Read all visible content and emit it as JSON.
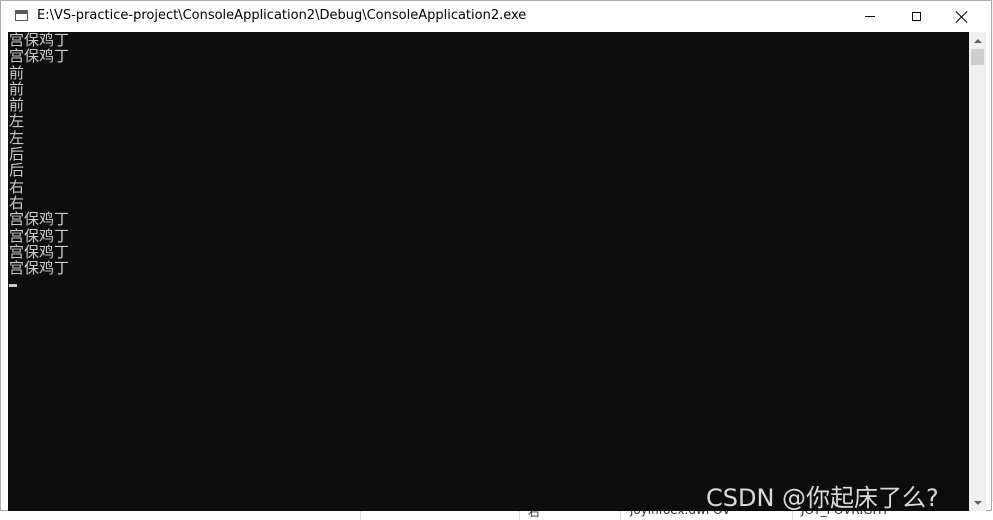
{
  "window": {
    "title": "E:\\VS-practice-project\\ConsoleApplication2\\Debug\\ConsoleApplication2.exe"
  },
  "console": {
    "lines": [
      "宫保鸡丁",
      "宫保鸡丁",
      "前",
      "前",
      "前",
      "左",
      "左",
      "后",
      "后",
      "右",
      "右",
      "宫保鸡丁",
      "宫保鸡丁",
      "宫保鸡丁",
      "宫保鸡丁"
    ]
  },
  "background": {
    "cell_1": "右",
    "cell_2": "joyinfoex.dwPOV",
    "cell_3": "JOY_POVRIGHT"
  },
  "watermark": "CSDN @你起床了么?",
  "colors": {
    "console_bg": "#0c0c0c",
    "console_text": "#cccccc",
    "titlebar_bg": "#ffffff"
  }
}
